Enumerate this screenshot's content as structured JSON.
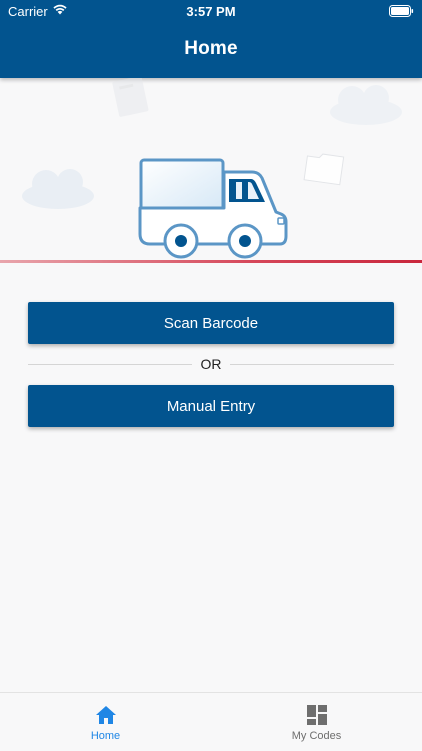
{
  "status_bar": {
    "carrier": "Carrier",
    "time": "3:57 PM"
  },
  "header": {
    "title": "Home"
  },
  "actions": {
    "scan_label": "Scan Barcode",
    "separator_label": "OR",
    "manual_label": "Manual Entry"
  },
  "tabbar": {
    "items": [
      {
        "label": "Home",
        "icon": "home-icon",
        "active": true
      },
      {
        "label": "My Codes",
        "icon": "grid-icon",
        "active": false
      }
    ]
  },
  "colors": {
    "primary": "#02548f",
    "accent_active": "#1f86e5",
    "divider": "#d6475a"
  }
}
